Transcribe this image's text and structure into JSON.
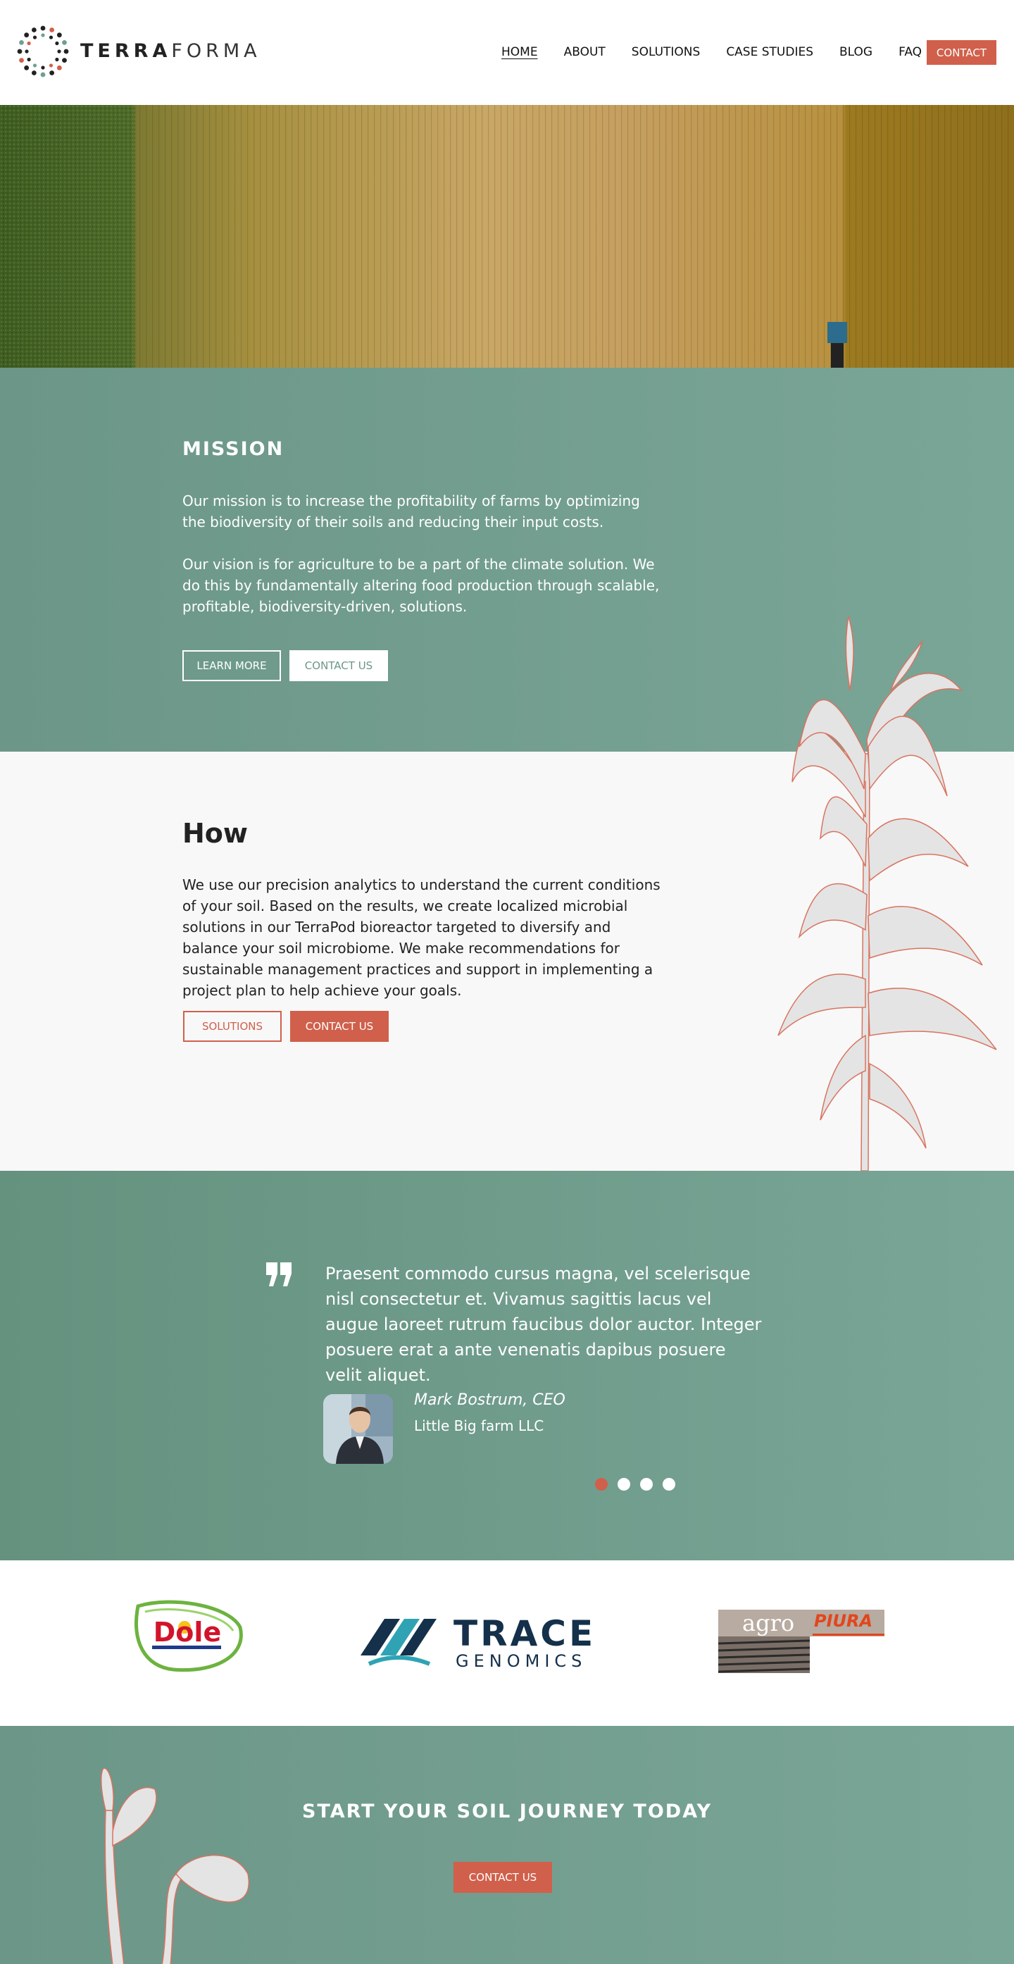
{
  "header": {
    "brand_bold": "TERRA",
    "brand_light": "FORMA",
    "nav": [
      {
        "label": "HOME",
        "active": true
      },
      {
        "label": "ABOUT",
        "active": false
      },
      {
        "label": "SOLUTIONS",
        "active": false
      },
      {
        "label": "CASE STUDIES",
        "active": false
      },
      {
        "label": "BLOG",
        "active": false
      },
      {
        "label": "FAQ",
        "active": false
      }
    ],
    "contact_label": "CONTACT"
  },
  "mission": {
    "title": "MISSION",
    "paragraph1": "Our mission is to increase the profitability of farms by optimizing the biodiversity of their soils and reducing their input costs.",
    "paragraph2": "Our vision is for agriculture to be a part of the climate solution. We do this by fundamentally altering food production through scalable, profitable, biodiversity-driven, solutions.",
    "learn_more_label": "LEARN MORE",
    "contact_us_label": "CONTACT US"
  },
  "how": {
    "title": "How",
    "paragraph": "We use our precision analytics to understand the current conditions of your soil. Based on the results, we create localized microbial solutions in our TerraPod bioreactor targeted to diversify and balance your soil microbiome. We make recommendations for sustainable management practices and support in implementing a project plan to help achieve your goals.",
    "solutions_label": "SOLUTIONS",
    "contact_us_label": "CONTACT US"
  },
  "testimonial": {
    "quote": "Praesent commodo cursus magna, vel scelerisque nisl consectetur et. Vivamus sagittis lacus vel augue laoreet rutrum faucibus dolor auctor. Integer posuere erat a ante venenatis dapibus posuere velit aliquet.",
    "author": "Mark Bostrum, CEO",
    "company": "Little Big farm LLC",
    "slides": 4,
    "active_slide": 1
  },
  "partners": {
    "dole": "Dole",
    "trace_word": "TRACE",
    "trace_sub": "GENOMICS",
    "agro_left": "agro",
    "agro_right": "PIURA"
  },
  "cta": {
    "title": "START YOUR SOIL JOURNEY TODAY",
    "button_label": "CONTACT US"
  },
  "colors": {
    "accent": "#d0604b",
    "green": "#6b9688",
    "dark_navy": "#14304a"
  }
}
